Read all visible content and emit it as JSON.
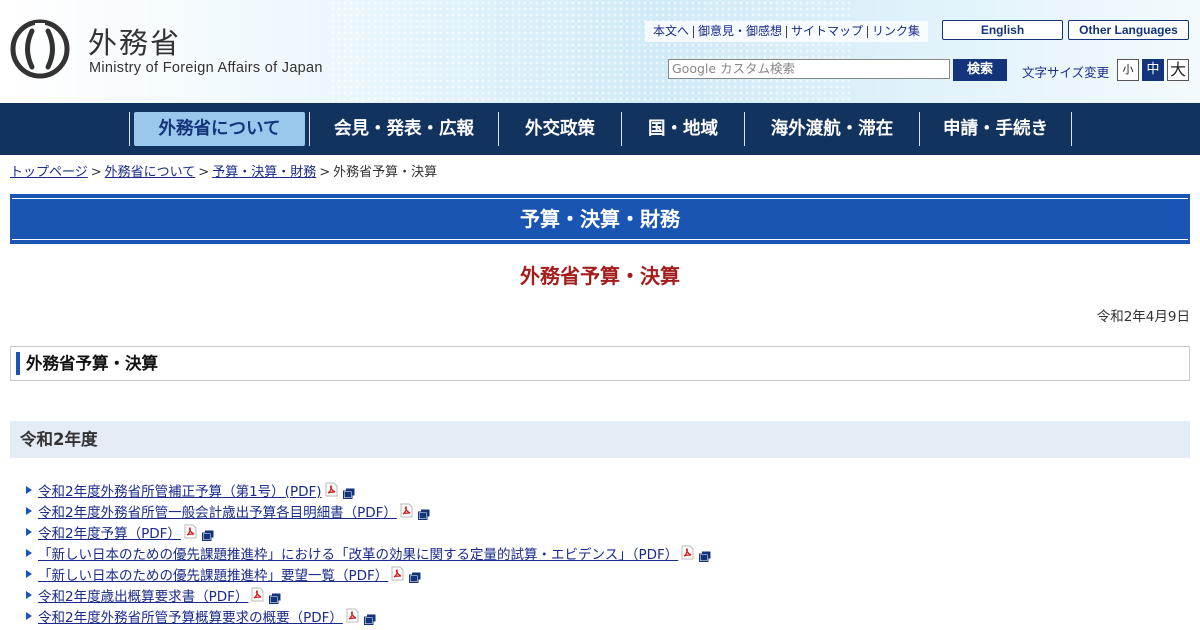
{
  "header": {
    "logo_text": "外務省",
    "logo_subtitle": "Ministry of Foreign Affairs of Japan",
    "utility_links": [
      "本文へ",
      "御意見・御感想",
      "サイトマップ",
      "リンク集"
    ],
    "english_label": "English",
    "other_languages_label": "Other Languages",
    "search_placeholder": "Google カスタム検索",
    "search_button": "検索",
    "font_size_label": "文字サイズ変更",
    "font_sizes": [
      "小",
      "中",
      "大"
    ],
    "font_size_active": "中"
  },
  "nav": {
    "items": [
      "外務省について",
      "会見・発表・広報",
      "外交政策",
      "国・地域",
      "海外渡航・滞在",
      "申請・手続き"
    ],
    "active": "外務省について"
  },
  "breadcrumb": {
    "links": [
      "トップページ",
      "外務省について",
      "予算・決算・財務"
    ],
    "current": "外務省予算・決算"
  },
  "section_title": "予算・決算・財務",
  "page_title": "外務省予算・決算",
  "date": "令和2年4月9日",
  "subheading": "外務省予算・決算",
  "year_heading": "令和2年度",
  "documents": [
    "令和2年度外務省所管補正予算（第1号）(PDF)",
    "令和2年度外務省所管一般会計歳出予算各目明細書（PDF）",
    "令和2年度予算（PDF）",
    "「新しい日本のための優先課題推進枠」における「改革の効果に関する定量的試算・エビデンス」（PDF）",
    "「新しい日本のための優先課題推進枠」要望一覧（PDF）",
    "令和2年度歳出概算要求書（PDF）",
    "令和2年度外務省所管予算概算要求の概要（PDF）"
  ],
  "colors": {
    "nav_bg": "#13335f",
    "nav_active_bg": "#9ac7ec",
    "section_band": "#1a55b4",
    "page_title": "#a51c1c",
    "link": "#1a2a8a",
    "year_band": "#e4ecf6"
  }
}
